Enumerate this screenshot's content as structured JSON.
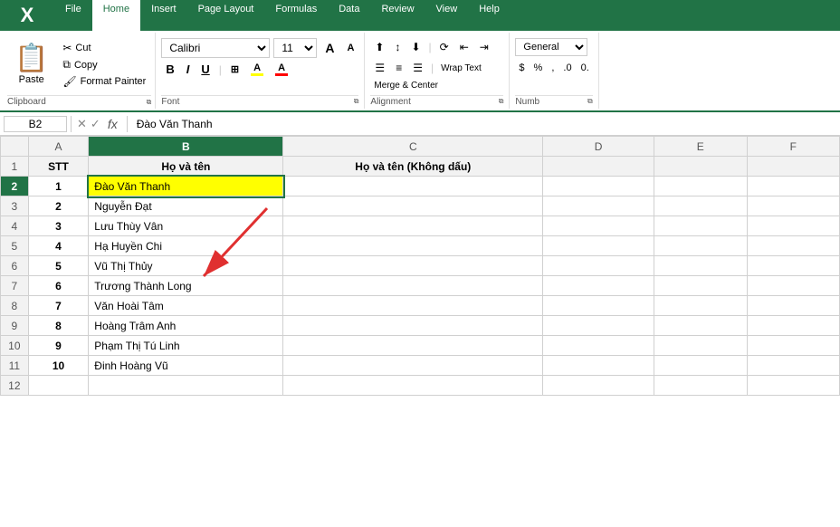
{
  "ribbon": {
    "tabs": [
      "File",
      "Home",
      "Insert",
      "Page Layout",
      "Formulas",
      "Data",
      "Review",
      "View",
      "Help"
    ],
    "active_tab": "Home",
    "clipboard": {
      "paste_label": "Paste",
      "cut_label": "Cut",
      "copy_label": "Copy",
      "format_painter_label": "Format Painter",
      "group_label": "Clipboard"
    },
    "font": {
      "font_name": "Calibri",
      "font_size": "11",
      "grow_label": "A",
      "shrink_label": "A",
      "bold_label": "B",
      "italic_label": "I",
      "underline_label": "U",
      "group_label": "Font"
    },
    "alignment": {
      "wrap_text_label": "Wrap Text",
      "merge_center_label": "Merge & Center",
      "group_label": "Alignment"
    },
    "number": {
      "format_label": "General",
      "group_label": "Numb"
    }
  },
  "formula_bar": {
    "cell_ref": "B2",
    "cancel_icon": "✕",
    "confirm_icon": "✓",
    "fx_label": "fx",
    "formula_value": "Đào Văn Thanh"
  },
  "columns": [
    "",
    "A",
    "B",
    "C",
    "D",
    "E",
    "F"
  ],
  "column_headers": {
    "A": "STT",
    "B": "Họ và tên",
    "C": "Họ và tên (Không dấu)",
    "D": "",
    "E": "",
    "F": ""
  },
  "rows": [
    {
      "row_num": "1",
      "A": "STT",
      "B": "Họ và tên",
      "C": "Họ và tên (Không dấu)",
      "D": "",
      "E": "",
      "F": ""
    },
    {
      "row_num": "2",
      "A": "1",
      "B": "Đào Văn Thanh",
      "C": "",
      "D": "",
      "E": "",
      "F": ""
    },
    {
      "row_num": "3",
      "A": "2",
      "B": "Nguyễn Đạt",
      "C": "",
      "D": "",
      "E": "",
      "F": ""
    },
    {
      "row_num": "4",
      "A": "3",
      "B": "Lưu Thùy Vân",
      "C": "",
      "D": "",
      "E": "",
      "F": ""
    },
    {
      "row_num": "5",
      "A": "4",
      "B": "Hạ Huyền Chi",
      "C": "",
      "D": "",
      "E": "",
      "F": ""
    },
    {
      "row_num": "6",
      "A": "5",
      "B": "Vũ Thị Thủy",
      "C": "",
      "D": "",
      "E": "",
      "F": ""
    },
    {
      "row_num": "7",
      "A": "6",
      "B": "Trương Thành Long",
      "C": "",
      "D": "",
      "E": "",
      "F": ""
    },
    {
      "row_num": "8",
      "A": "7",
      "B": "Văn Hoài Tâm",
      "C": "",
      "D": "",
      "E": "",
      "F": ""
    },
    {
      "row_num": "9",
      "A": "8",
      "B": "Hoàng Trâm Anh",
      "C": "",
      "D": "",
      "E": "",
      "F": ""
    },
    {
      "row_num": "10",
      "A": "9",
      "B": "Phạm Thị Tú Linh",
      "C": "",
      "D": "",
      "E": "",
      "F": ""
    },
    {
      "row_num": "11",
      "A": "10",
      "B": "Đinh Hoàng Vũ",
      "C": "",
      "D": "",
      "E": "",
      "F": ""
    },
    {
      "row_num": "12",
      "A": "",
      "B": "",
      "C": "",
      "D": "",
      "E": "",
      "F": ""
    }
  ],
  "selected_cell": "B2",
  "colors": {
    "excel_green": "#217346",
    "ribbon_bg": "#fff",
    "selected_bg": "#ffff00",
    "header_bg": "#f2f2f2"
  },
  "arrow": {
    "visible": true
  }
}
